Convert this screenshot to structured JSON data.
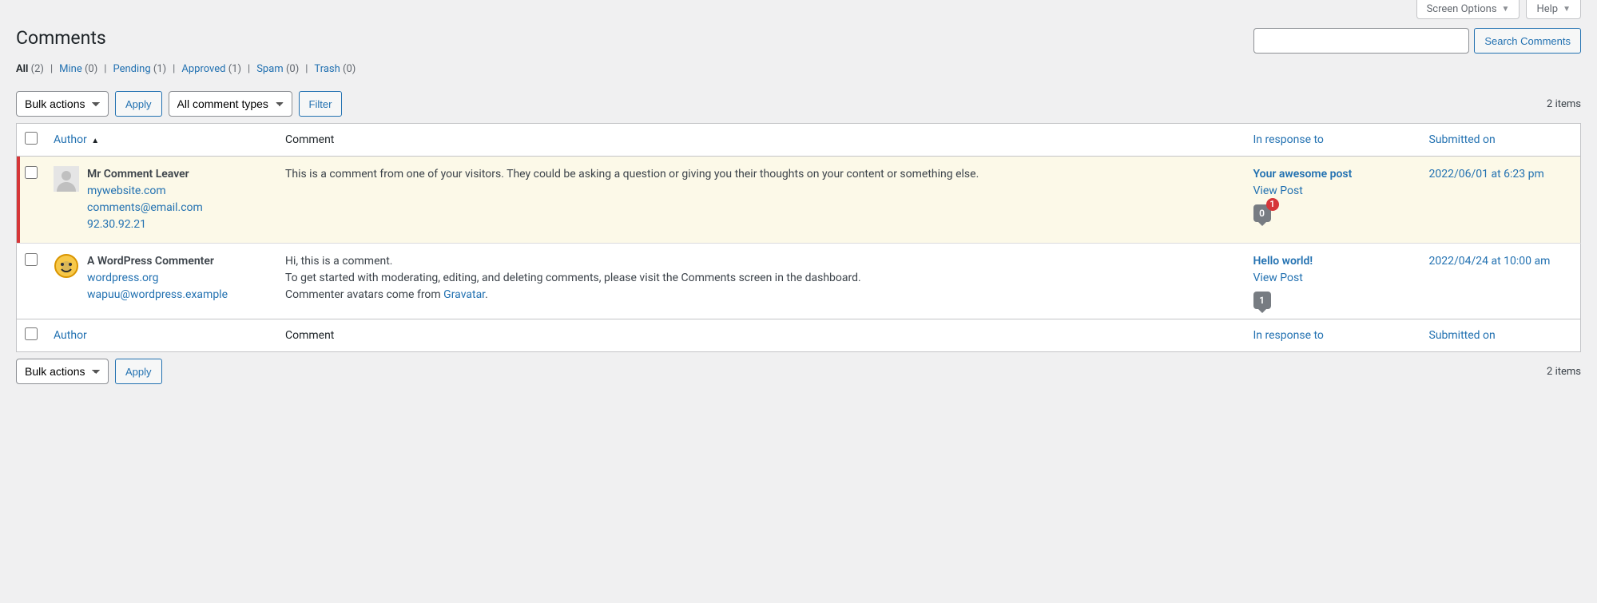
{
  "top": {
    "screen_options": "Screen Options",
    "help": "Help"
  },
  "page_title": "Comments",
  "filters": {
    "all_label": "All",
    "all_count": "(2)",
    "mine_label": "Mine",
    "mine_count": "(0)",
    "pending_label": "Pending",
    "pending_count": "(1)",
    "approved_label": "Approved",
    "approved_count": "(1)",
    "spam_label": "Spam",
    "spam_count": "(0)",
    "trash_label": "Trash",
    "trash_count": "(0)"
  },
  "search": {
    "button": "Search Comments"
  },
  "bulk": {
    "placeholder": "Bulk actions",
    "apply": "Apply",
    "comment_types": "All comment types",
    "filter": "Filter"
  },
  "pagination": {
    "items_text": "2 items"
  },
  "columns": {
    "author": "Author",
    "comment": "Comment",
    "response": "In response to",
    "date": "Submitted on"
  },
  "rows": [
    {
      "status": "unapproved",
      "author_name": "Mr Comment Leaver",
      "author_site": "mywebsite.com",
      "author_email": "comments@email.com",
      "author_ip": "92.30.92.21",
      "comment_text": "This is a comment from one of your visitors. They could be asking a question or giving you their thoughts on your content or something else.",
      "post_title": "Your awesome post",
      "view_post": "View Post",
      "bubble_count": "0",
      "bubble_pending": "1",
      "date": "2022/06/01 at 6:23 pm"
    },
    {
      "status": "approved",
      "author_name": "A WordPress Commenter",
      "author_site": "wordpress.org",
      "author_email": "wapuu@wordpress.example",
      "author_ip": "",
      "comment_line1": "Hi, this is a comment.",
      "comment_line2": "To get started with moderating, editing, and deleting comments, please visit the Comments screen in the dashboard.",
      "comment_line3a": "Commenter avatars come from ",
      "comment_link": "Gravatar",
      "comment_line3b": ".",
      "post_title": "Hello world!",
      "view_post": "View Post",
      "bubble_count": "1",
      "date": "2022/04/24 at 10:00 am"
    }
  ]
}
